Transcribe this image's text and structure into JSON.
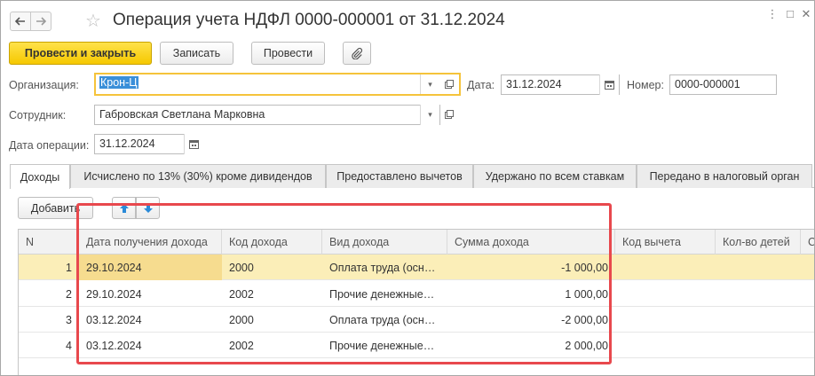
{
  "window": {
    "title": "Операция учета НДФЛ 0000-000001 от 31.12.2024"
  },
  "toolbar": {
    "post_close": "Провести и закрыть",
    "save": "Записать",
    "post": "Провести"
  },
  "form": {
    "organization_label": "Организация:",
    "organization_value": "Крон-Ц",
    "date_label": "Дата:",
    "date_value": "31.12.2024",
    "number_label": "Номер:",
    "number_value": "0000-000001",
    "employee_label": "Сотрудник:",
    "employee_value": "Габровская Светлана Марковна",
    "op_date_label": "Дата операции:",
    "op_date_value": "31.12.2024"
  },
  "tabs": [
    {
      "label": "Доходы",
      "active": true
    },
    {
      "label": "Исчислено по 13% (30%) кроме дивидендов",
      "active": false
    },
    {
      "label": "Предоставлено вычетов",
      "active": false
    },
    {
      "label": "Удержано по всем ставкам",
      "active": false
    },
    {
      "label": "Передано в налоговый орган",
      "active": false
    }
  ],
  "table_toolbar": {
    "add": "Добавить"
  },
  "table": {
    "columns": [
      "N",
      "Дата получения дохода",
      "Код дохода",
      "Вид дохода",
      "Сумма дохода",
      "Код вычета",
      "Кол-во детей",
      "С"
    ],
    "rows": [
      {
        "n": "1",
        "date": "29.10.2024",
        "code": "2000",
        "type": "Оплата труда (осн…",
        "amount": "-1 000,00",
        "deduction": "",
        "children": ""
      },
      {
        "n": "2",
        "date": "29.10.2024",
        "code": "2002",
        "type": "Прочие денежные…",
        "amount": "1 000,00",
        "deduction": "",
        "children": ""
      },
      {
        "n": "3",
        "date": "03.12.2024",
        "code": "2000",
        "type": "Оплата труда (осн…",
        "amount": "-2 000,00",
        "deduction": "",
        "children": ""
      },
      {
        "n": "4",
        "date": "03.12.2024",
        "code": "2002",
        "type": "Прочие денежные…",
        "amount": "2 000,00",
        "deduction": "",
        "children": ""
      }
    ]
  },
  "colors": {
    "primary_button": "#f5c800",
    "selected_row": "#fbeeb8",
    "highlight_border": "#e8484d"
  }
}
